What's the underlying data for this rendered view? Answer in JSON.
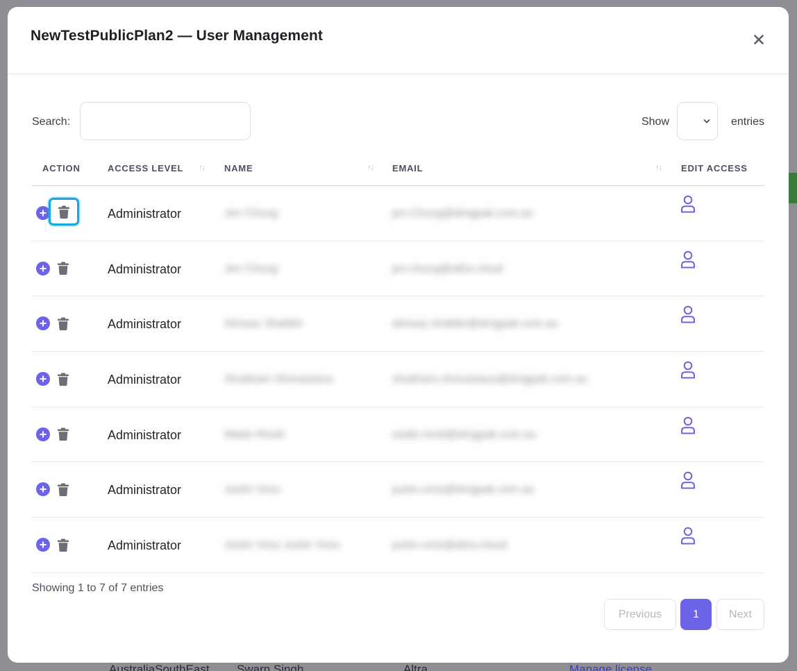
{
  "background": {
    "row_region": "AustraliaSouthEast",
    "row_user": "Swarn Singh",
    "row_type": "Altra",
    "row_link": "Manage license"
  },
  "modal": {
    "title": "NewTestPublicPlan2 — User Management",
    "close_label": "×"
  },
  "search": {
    "label": "Search:",
    "value": "",
    "placeholder": ""
  },
  "length": {
    "show_label": "Show",
    "entries_label": "entries",
    "selected": ""
  },
  "table": {
    "columns": [
      "ACTION",
      "ACCESS LEVEL",
      "NAME",
      "EMAIL",
      "EDIT ACCESS"
    ],
    "rows": [
      {
        "access": "Administrator",
        "name": "Jen Chung",
        "email": "jen.Chung@dmgpak.com.au"
      },
      {
        "access": "Administrator",
        "name": "Jen Chung",
        "email": "jen.chung@altra.cloud"
      },
      {
        "access": "Administrator",
        "name": "Almaaz Shabbir",
        "email": "almaaz.shabbir@dmgpak.com.au"
      },
      {
        "access": "Administrator",
        "name": "Shubham Shrivastava",
        "email": "shubham.shrivastava@dmgpak.com.au"
      },
      {
        "access": "Administrator",
        "name": "Wade Rivett",
        "email": "wade.rivett@dmgpak.com.au"
      },
      {
        "access": "Administrator",
        "name": "Justin Voss",
        "email": "justin.voss@dmgpak.com.au"
      },
      {
        "access": "Administrator",
        "name": "Justin Voss Justin Voss",
        "email": "justin.voss@altra.cloud"
      }
    ]
  },
  "footer": {
    "showing": "Showing 1 to 7 of 7 entries",
    "previous": "Previous",
    "page": "1",
    "next": "Next"
  },
  "colors": {
    "accent": "#6c63e6",
    "focus_ring": "#1aa7df",
    "trash": "#6b6e75"
  },
  "icons": [
    "close-icon",
    "plus-circle-icon",
    "trash-icon",
    "user-icon",
    "chevron-down-icon",
    "sort-icon"
  ]
}
